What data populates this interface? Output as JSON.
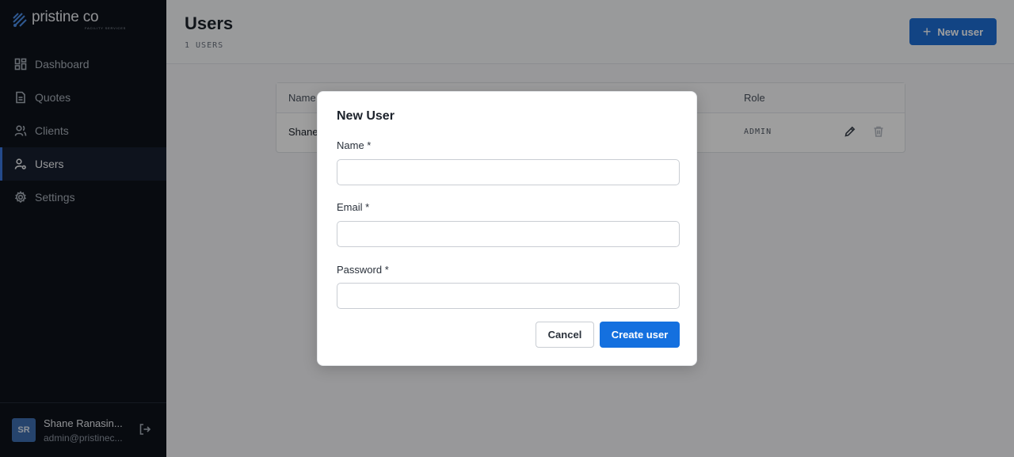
{
  "brand": {
    "name": "pristine co",
    "tagline": "FACILITY SERVICES",
    "icon": "diamond-logo-icon",
    "accent": "#1d6fd6"
  },
  "sidebar": {
    "items": [
      {
        "label": "Dashboard",
        "icon": "dashboard-icon",
        "active": false
      },
      {
        "label": "Quotes",
        "icon": "document-icon",
        "active": false
      },
      {
        "label": "Clients",
        "icon": "clients-icon",
        "active": false
      },
      {
        "label": "Users",
        "icon": "user-cog-icon",
        "active": true
      },
      {
        "label": "Settings",
        "icon": "gear-icon",
        "active": false
      }
    ],
    "user": {
      "initials": "SR",
      "name": "Shane Ranasin...",
      "email": "admin@pristinec...",
      "logout_icon": "logout-icon"
    }
  },
  "header": {
    "title": "Users",
    "count": "1 USERS",
    "new_user_label": "New user"
  },
  "table": {
    "columns": [
      "Name",
      "Role"
    ],
    "rows": [
      {
        "name": "Shane",
        "role": "ADMIN"
      }
    ]
  },
  "modal": {
    "title": "New User",
    "fields": [
      {
        "label": "Name *",
        "value": "",
        "placeholder": ""
      },
      {
        "label": "Email *",
        "value": "",
        "placeholder": ""
      },
      {
        "label": "Password *",
        "value": "",
        "placeholder": ""
      }
    ],
    "cancel_label": "Cancel",
    "create_label": "Create user"
  }
}
